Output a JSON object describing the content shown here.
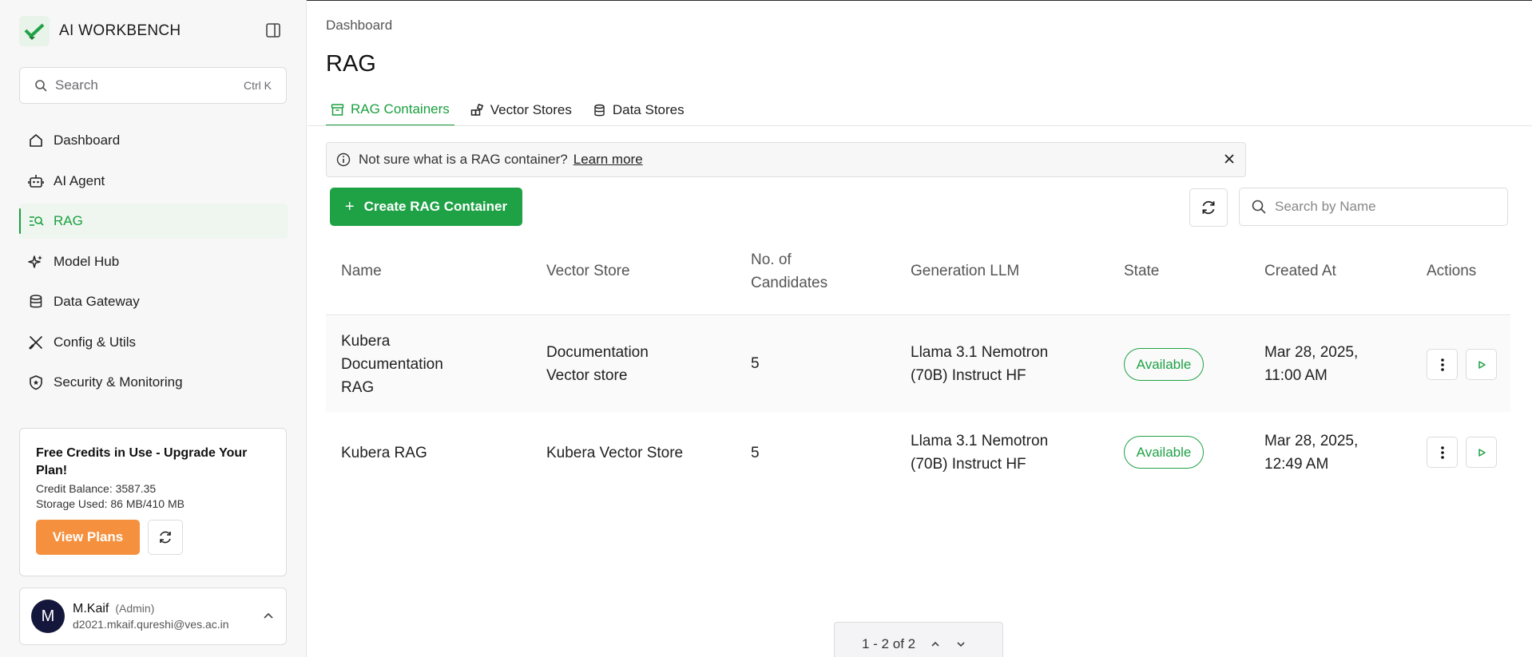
{
  "brand": {
    "name": "AI WORKBENCH"
  },
  "sidebar": {
    "search": {
      "placeholder": "Search",
      "shortcut": "Ctrl K"
    },
    "items": [
      {
        "label": "Dashboard",
        "icon": "home-icon",
        "active": false
      },
      {
        "label": "AI Agent",
        "icon": "robot-icon",
        "active": false
      },
      {
        "label": "RAG",
        "icon": "rag-search-icon",
        "active": true
      },
      {
        "label": "Model Hub",
        "icon": "sparkles-icon",
        "active": false
      },
      {
        "label": "Data Gateway",
        "icon": "database-icon",
        "active": false
      },
      {
        "label": "Config & Utils",
        "icon": "tools-icon",
        "active": false
      },
      {
        "label": "Security & Monitoring",
        "icon": "shield-icon",
        "active": false
      }
    ]
  },
  "credits": {
    "title": "Free Credits in Use - Upgrade Your Plan!",
    "balance": "Credit Balance: 3587.35",
    "storage": "Storage Used: 86 MB/410 MB",
    "view_plans": "View Plans"
  },
  "user": {
    "initial": "M",
    "name": "M.Kaif",
    "role": "(Admin)",
    "email": "d2021.mkaif.qureshi@ves.ac.in"
  },
  "main": {
    "breadcrumb": "Dashboard",
    "title": "RAG",
    "tabs": [
      {
        "label": "RAG Containers",
        "icon": "container-icon",
        "active": true
      },
      {
        "label": "Vector Stores",
        "icon": "vector-icon",
        "active": false
      },
      {
        "label": "Data Stores",
        "icon": "database-icon",
        "active": false
      }
    ],
    "info": {
      "message": "Not sure what is a RAG container?",
      "link": "Learn more"
    },
    "create_button": "Create RAG Container",
    "search_placeholder": "Search by Name",
    "columns": {
      "name": "Name",
      "vector_store": "Vector Store",
      "candidates_1": "No. of",
      "candidates_2": "Candidates",
      "llm": "Generation LLM",
      "state": "State",
      "created": "Created At",
      "actions": "Actions"
    },
    "rows": [
      {
        "name": [
          "Kubera",
          "Documentation",
          "RAG"
        ],
        "vector_store": [
          "Documentation",
          "Vector store"
        ],
        "candidates": "5",
        "llm": [
          "Llama 3.1 Nemotron",
          "(70B) Instruct HF"
        ],
        "state": "Available",
        "created": [
          "Mar 28, 2025,",
          "11:00 AM"
        ]
      },
      {
        "name": [
          "Kubera RAG"
        ],
        "vector_store": [
          "Kubera Vector Store"
        ],
        "candidates": "5",
        "llm": [
          "Llama 3.1 Nemotron",
          "(70B) Instruct HF"
        ],
        "state": "Available",
        "created": [
          "Mar 28, 2025,",
          "12:49 AM"
        ]
      }
    ],
    "pagination": "1 - 2 of 2"
  },
  "colors": {
    "accent": "#1fa246",
    "orange": "#f5913e",
    "avatar": "#14163b"
  }
}
